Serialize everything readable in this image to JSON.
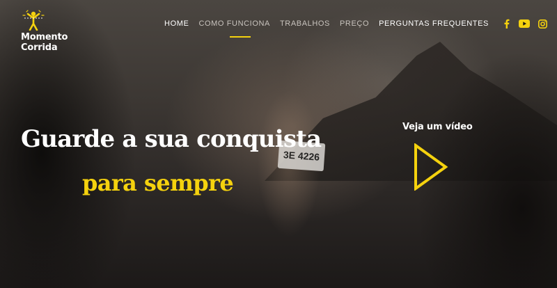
{
  "brand": {
    "name": "Momento Corrida",
    "logo_icon": "runner-finish-icon"
  },
  "nav": {
    "items": [
      {
        "label": "HOME",
        "active": true
      },
      {
        "label": "COMO FUNCIONA",
        "active": false
      },
      {
        "label": "TRABALHOS",
        "active": false
      },
      {
        "label": "PREÇO",
        "active": false
      },
      {
        "label": "PERGUNTAS FREQUENTES",
        "active": false
      }
    ],
    "social": [
      "facebook-icon",
      "youtube-icon",
      "instagram-icon"
    ]
  },
  "hero": {
    "headline": "Guarde a sua conquista",
    "subheadline": "para sempre",
    "bib_number": "3E 4226",
    "video_label": "Veja um vídeo"
  },
  "colors": {
    "accent": "#f5d20e",
    "text": "#ffffff",
    "nav_inactive": "#c9c4be"
  }
}
